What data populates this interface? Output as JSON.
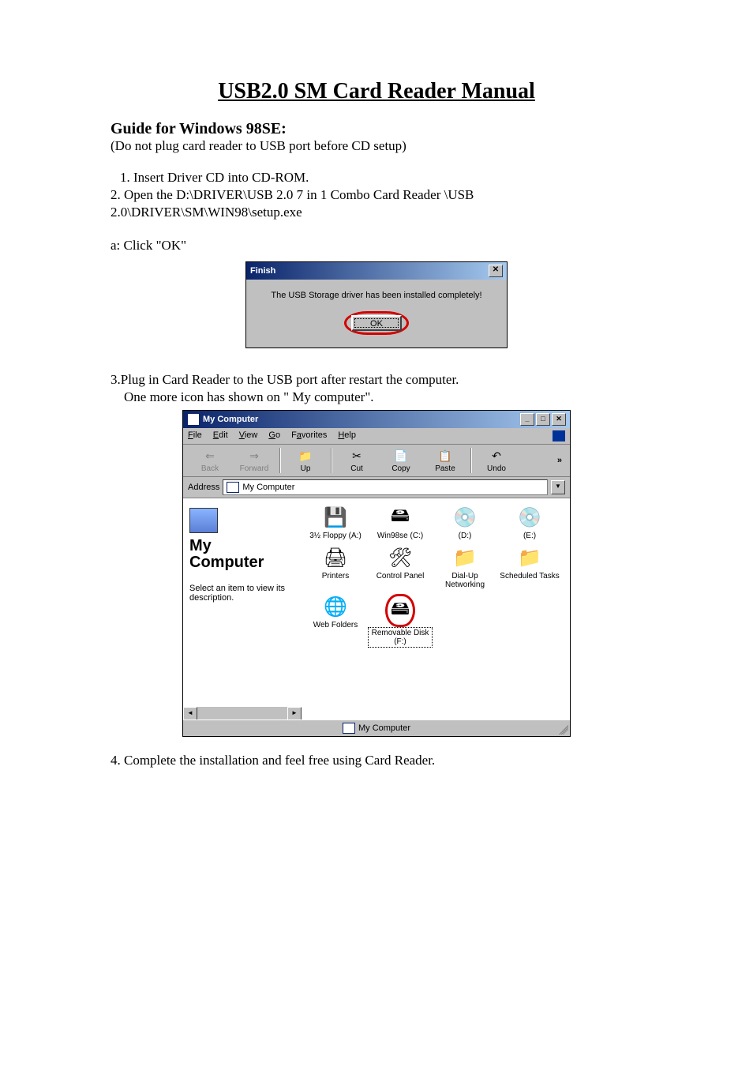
{
  "doc": {
    "title": "USB2.0 SM Card Reader Manual",
    "subtitle": "Guide for Windows 98SE:",
    "note": " (Do not plug card reader to USB port before CD setup)",
    "step1": "  1. Insert Driver CD into CD-ROM.",
    "step2a": "2. Open the D:\\DRIVER\\USB 2.0 7 in 1 Combo Card Reader \\USB",
    "step2b": "2.0\\DRIVER\\SM\\WIN98\\setup.exe",
    "stepA": "a: Click \"OK\"",
    "step3a": "3.Plug in Card Reader to the USB port after restart the computer.",
    "step3b": "    One more icon has shown on \" My computer\".",
    "step4": "4. Complete the installation and feel free using Card Reader."
  },
  "finish": {
    "title": "Finish",
    "close": "✕",
    "message": "The USB Storage driver has been installed completely!",
    "ok": "OK"
  },
  "mc": {
    "title": "My Computer",
    "btn_min": "_",
    "btn_max": "□",
    "btn_close": "✕",
    "menu": {
      "file": "File",
      "edit": "Edit",
      "view": "View",
      "go": "Go",
      "fav": "Favorites",
      "help": "Help"
    },
    "toolbar": {
      "back": "Back",
      "forward": "Forward",
      "up": "Up",
      "cut": "Cut",
      "copy": "Copy",
      "paste": "Paste",
      "undo": "Undo",
      "more": "»"
    },
    "address_label": "Address",
    "address_value": "My Computer",
    "side": {
      "line1": "My",
      "line2": "Computer",
      "desc": "Select an item to view its description."
    },
    "icons": {
      "floppy": "3½ Floppy (A:)",
      "c": "Win98se (C:)",
      "d": "(D:)",
      "e": "(E:)",
      "printers": "Printers",
      "cpanel": "Control Panel",
      "dialup": "Dial-Up Networking",
      "sched": "Scheduled Tasks",
      "webf": "Web Folders",
      "remov": "Removable Disk (F:)"
    },
    "status": "My Computer"
  },
  "glyphs": {
    "back": "⇐",
    "forward": "⇒",
    "up": "📁",
    "cut": "✂",
    "copy": "📄",
    "paste": "📋",
    "undo": "↶",
    "floppy": "💾",
    "hdd": "🖴",
    "cd": "💿",
    "printer": "🖨",
    "cpanel": "🛠",
    "dialup": "📁",
    "sched": "📁",
    "webf": "🌐",
    "drive": "🖴"
  }
}
